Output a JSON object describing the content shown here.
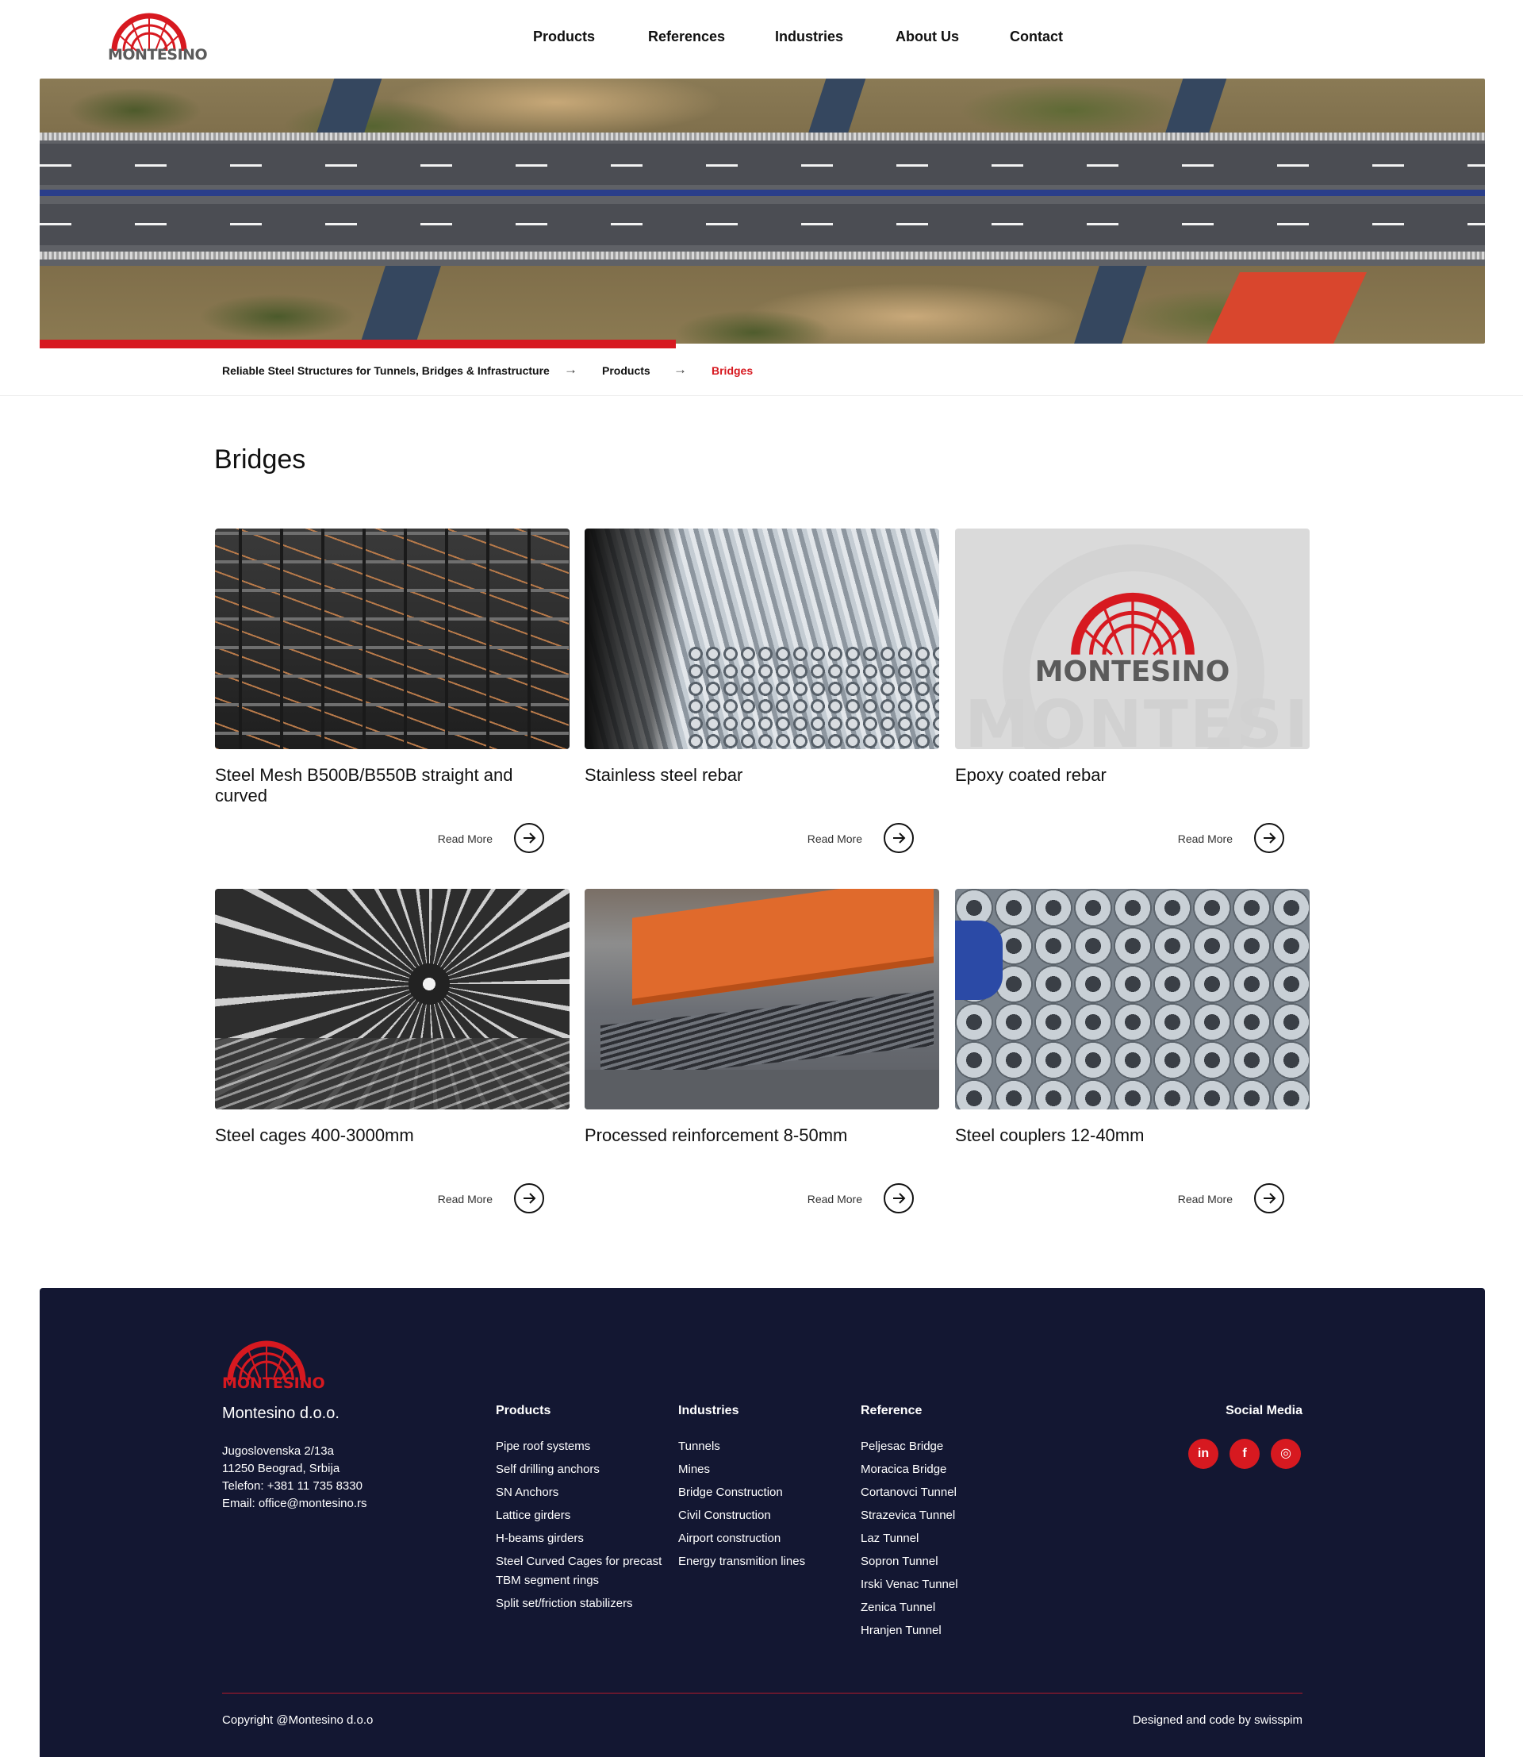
{
  "brand": {
    "name": "MONTESINO",
    "red": "#d71920",
    "navy": "#131732"
  },
  "nav": {
    "items": [
      {
        "label": "Products"
      },
      {
        "label": "References"
      },
      {
        "label": "Industries"
      },
      {
        "label": "About Us"
      },
      {
        "label": "Contact"
      }
    ]
  },
  "hero": {
    "progress_fraction": 0.44
  },
  "breadcrumb": {
    "items": [
      {
        "label": "Reliable Steel Structures for Tunnels, Bridges & Infrastructure"
      },
      {
        "label": "Products"
      },
      {
        "label": "Bridges"
      }
    ]
  },
  "page": {
    "title": "Bridges"
  },
  "products": [
    {
      "title": "Steel Mesh B500B/B550B straight and curved",
      "read_more": "Read More"
    },
    {
      "title": "Stainless steel rebar",
      "read_more": "Read More"
    },
    {
      "title": "Epoxy coated rebar",
      "read_more": "Read More"
    },
    {
      "title": "Steel cages 400-3000mm",
      "read_more": "Read More"
    },
    {
      "title": "Processed reinforcement 8-50mm",
      "read_more": "Read More"
    },
    {
      "title": "Steel couplers 12-40mm",
      "read_more": "Read More"
    }
  ],
  "footer": {
    "logo_text": "MONTESINO",
    "company": "Montesino d.o.o.",
    "address": [
      "Jugoslovenska 2/13a",
      "11250 Beograd, Srbija",
      "Telefon: +381 11 735 8330",
      "Email: office@montesino.rs"
    ],
    "products": {
      "heading": "Products",
      "links": [
        "Pipe roof systems",
        "Self drilling anchors",
        "SN Anchors",
        "Lattice girders",
        "H-beams girders",
        "Steel Curved Cages for precast TBM segment rings",
        "Split set/friction stabilizers"
      ]
    },
    "industries": {
      "heading": "Industries",
      "links": [
        "Tunnels",
        "Mines",
        "Bridge Construction",
        "Civil Construction",
        "Airport construction",
        "Energy transmition lines"
      ]
    },
    "reference": {
      "heading": "Reference",
      "links": [
        "Peljesac Bridge",
        "Moracica Bridge",
        "Cortanovci Tunnel",
        "Strazevica Tunnel",
        "Laz Tunnel",
        "Sopron Tunnel",
        "Irski Venac Tunnel",
        "Zenica Tunnel",
        "Hranjen Tunnel"
      ]
    },
    "social": {
      "heading": "Social Media",
      "icons": [
        {
          "name": "linkedin-icon",
          "glyph": "in"
        },
        {
          "name": "facebook-icon",
          "glyph": "f"
        },
        {
          "name": "instagram-icon",
          "glyph": "◎"
        }
      ]
    },
    "copyright": "Copyright @Montesino d.o.o",
    "credit": "Designed and code by swisspim"
  }
}
